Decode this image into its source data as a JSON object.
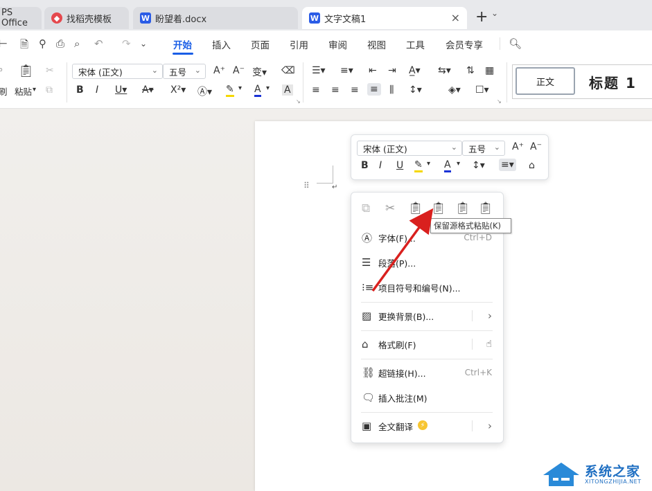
{
  "tabs": [
    {
      "label": "PS Office"
    },
    {
      "label": "找稻壳模板"
    },
    {
      "label": "盼望着.docx"
    },
    {
      "label": "文字文稿1"
    }
  ],
  "tab_controls": {
    "close": "×",
    "add": "+",
    "more": "⌄"
  },
  "menu": {
    "items": [
      "开始",
      "插入",
      "页面",
      "引用",
      "审阅",
      "视图",
      "工具",
      "会员专享"
    ],
    "active": "开始"
  },
  "ribbon": {
    "paste_label": "粘贴",
    "brush_label": "刷",
    "font_name": "宋体 (正文)",
    "font_size": "五号",
    "style_normal": "正文",
    "style_heading1": "标题 1"
  },
  "float_toolbar": {
    "font_name": "宋体 (正文)",
    "font_size": "五号"
  },
  "context_menu": {
    "items": [
      {
        "icon": "font-icon",
        "label": "字体(F)...",
        "shortcut": "Ctrl+D"
      },
      {
        "icon": "paragraph-icon",
        "label": "段落(P)..."
      },
      {
        "icon": "bullet-list-icon",
        "label": "项目符号和编号(N)..."
      },
      {
        "icon": "background-icon",
        "label": "更换背景(B)...",
        "submenu": "›"
      },
      {
        "icon": "format-painter-icon",
        "label": "格式刷(F)"
      },
      {
        "icon": "hyperlink-icon",
        "label": "超链接(H)...",
        "shortcut": "Ctrl+K"
      },
      {
        "icon": "comment-icon",
        "label": "插入批注(M)"
      },
      {
        "icon": "translate-icon",
        "label": "全文翻译",
        "submenu": "›"
      }
    ]
  },
  "tooltip": "保留源格式粘贴(K)",
  "watermark": {
    "title": "系统之家",
    "url": "XITONGZHIJIA.NET"
  },
  "colors": {
    "accent": "#1a5ee6",
    "arrow": "#d9201e",
    "word_icon": "#2b5ce6"
  }
}
